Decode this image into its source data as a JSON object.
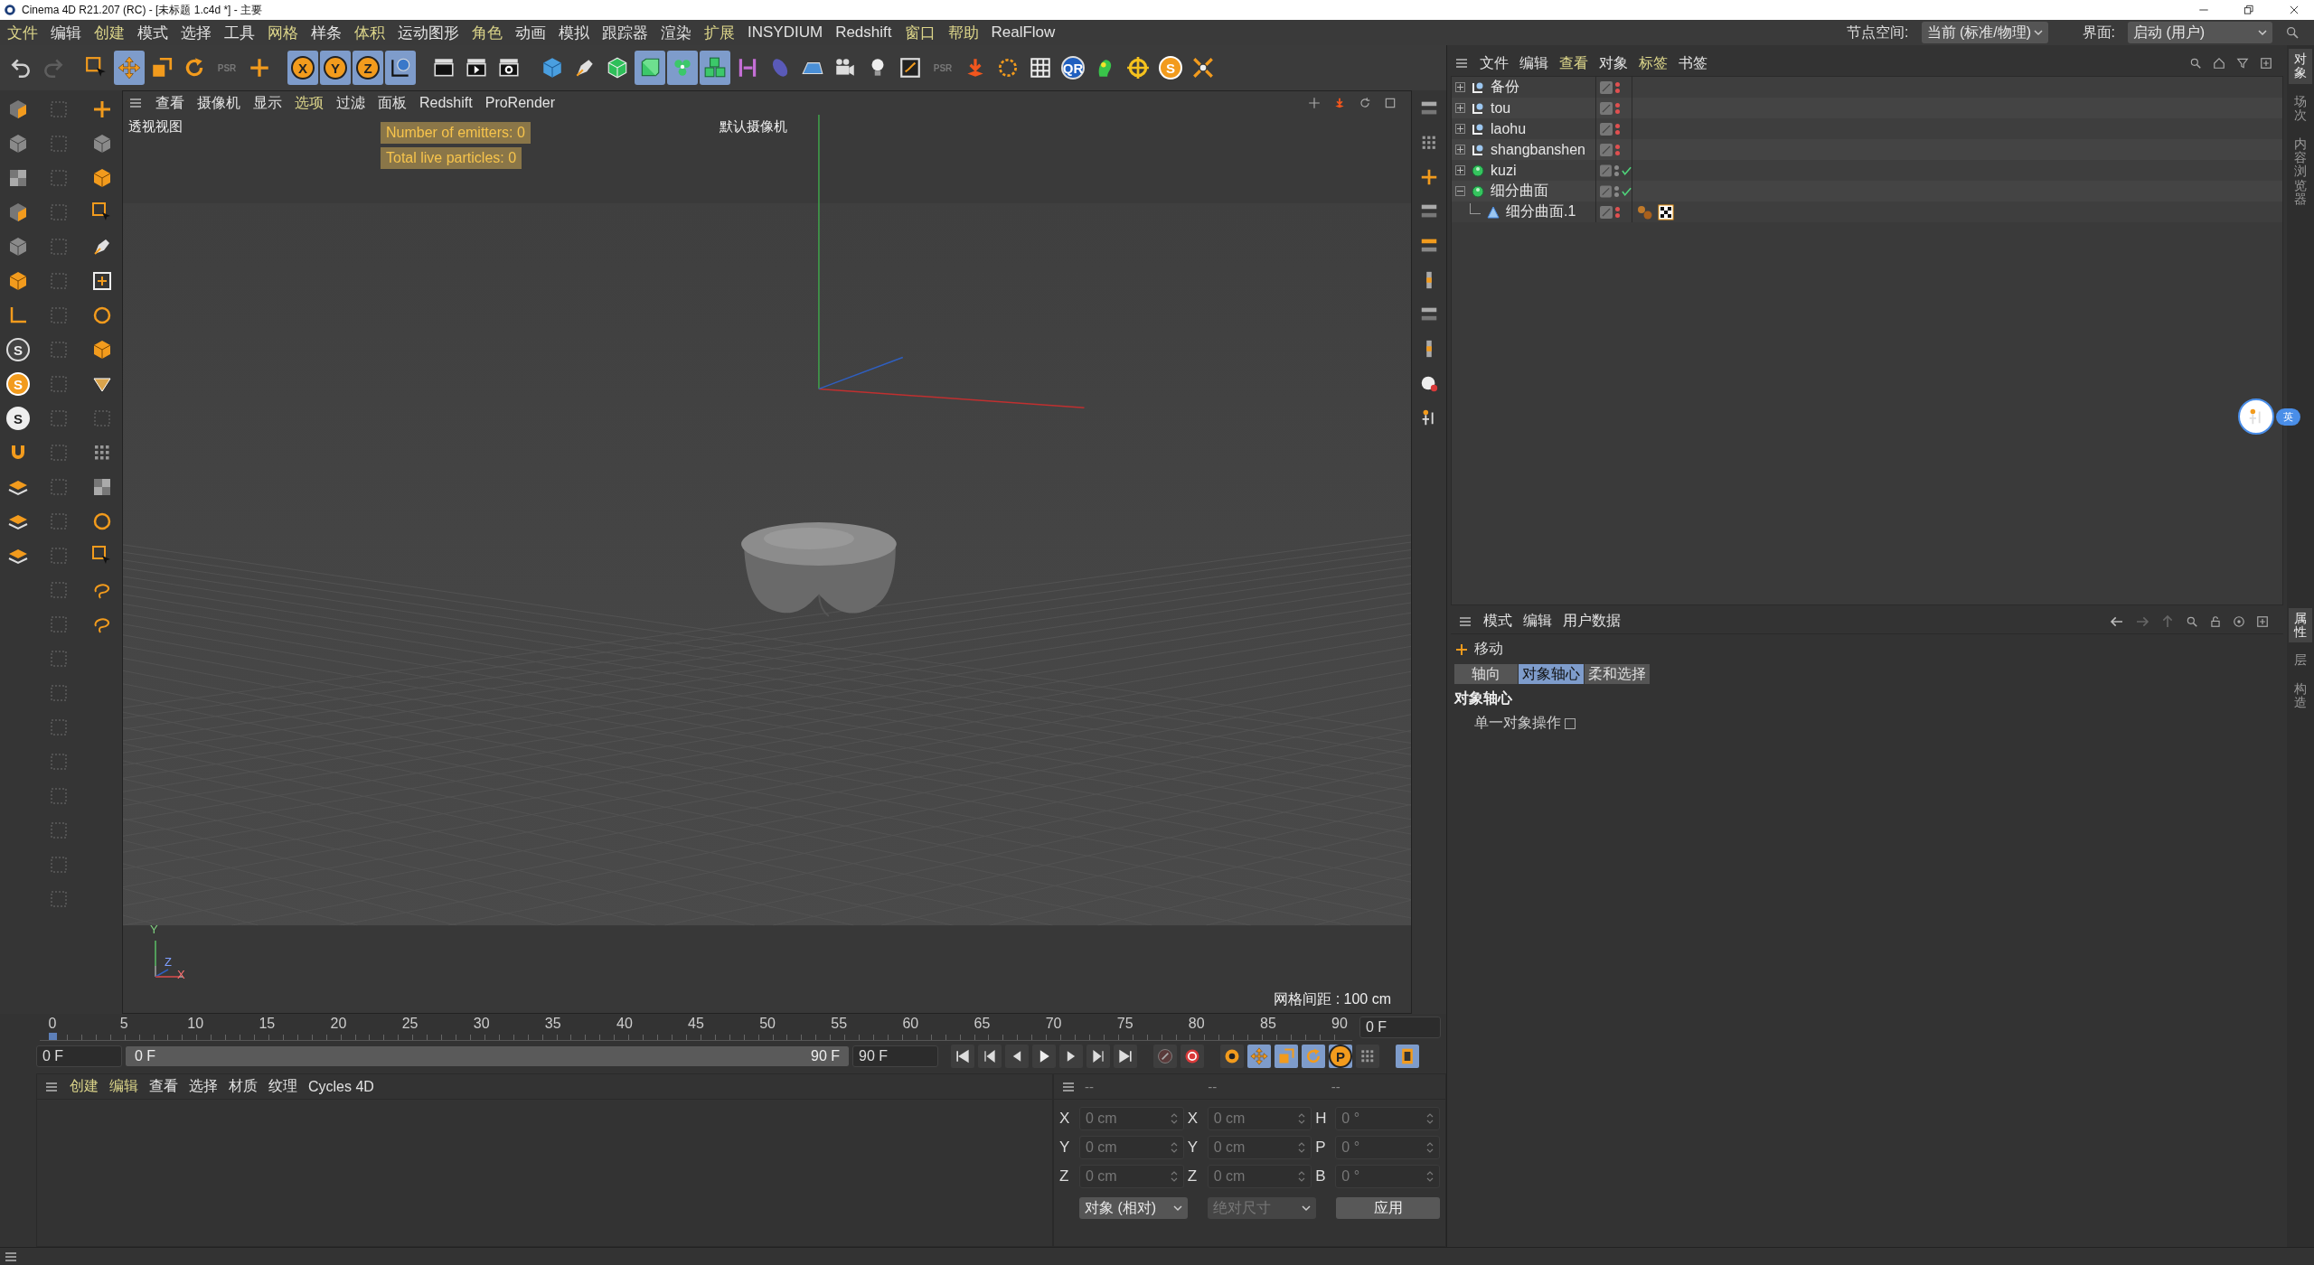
{
  "window": {
    "title": "Cinema 4D R21.207 (RC) - [未标题 1.c4d *] - 主要"
  },
  "menu": [
    {
      "label": "文件",
      "highlighted": true
    },
    {
      "label": "编辑",
      "highlighted": false
    },
    {
      "label": "创建",
      "highlighted": true
    },
    {
      "label": "模式",
      "highlighted": false
    },
    {
      "label": "选择",
      "highlighted": false
    },
    {
      "label": "工具",
      "highlighted": false
    },
    {
      "label": "网格",
      "highlighted": true
    },
    {
      "label": "样条",
      "highlighted": false
    },
    {
      "label": "体积",
      "highlighted": true
    },
    {
      "label": "运动图形",
      "highlighted": false
    },
    {
      "label": "角色",
      "highlighted": true
    },
    {
      "label": "动画",
      "highlighted": false
    },
    {
      "label": "模拟",
      "highlighted": false
    },
    {
      "label": "跟踪器",
      "highlighted": false
    },
    {
      "label": "渲染",
      "highlighted": false
    },
    {
      "label": "扩展",
      "highlighted": true
    },
    {
      "label": "INSYDIUM",
      "highlighted": false
    },
    {
      "label": "Redshift",
      "highlighted": false
    },
    {
      "label": "窗口",
      "highlighted": true
    },
    {
      "label": "帮助",
      "highlighted": true
    },
    {
      "label": "RealFlow",
      "highlighted": false
    }
  ],
  "node_space": {
    "label": "节点空间:",
    "value": "当前 (标准/物理)"
  },
  "interface": {
    "label": "界面:",
    "value": "启动 (用户)"
  },
  "toolbar": [
    {
      "kind": "undo",
      "active": false
    },
    {
      "kind": "redo",
      "active": false
    },
    {
      "kind": "gap"
    },
    {
      "kind": "select",
      "active": false
    },
    {
      "kind": "move",
      "active": true
    },
    {
      "kind": "scale",
      "active": false
    },
    {
      "kind": "rotate",
      "active": false
    },
    {
      "kind": "psr",
      "label": "PSR",
      "active": false
    },
    {
      "kind": "plus",
      "active": false
    },
    {
      "kind": "gap"
    },
    {
      "kind": "axis",
      "label": "X",
      "active": true
    },
    {
      "kind": "axis",
      "label": "Y",
      "active": true
    },
    {
      "kind": "axis",
      "label": "Z",
      "active": true
    },
    {
      "kind": "globe",
      "active": true
    },
    {
      "kind": "gap"
    },
    {
      "kind": "clapper",
      "active": false
    },
    {
      "kind": "clapper-play",
      "active": false
    },
    {
      "kind": "clapper-gear",
      "active": false
    },
    {
      "kind": "gap"
    },
    {
      "kind": "cube",
      "active": false
    },
    {
      "kind": "pen",
      "active": false
    },
    {
      "kind": "subdivision-cube",
      "active": false
    },
    {
      "kind": "solid-cube",
      "active": true
    },
    {
      "kind": "cube-cluster",
      "active": true
    },
    {
      "kind": "cubes",
      "active": true
    },
    {
      "kind": "bracket",
      "active": false
    },
    {
      "kind": "ellipse",
      "active": false
    },
    {
      "kind": "floor",
      "active": false
    },
    {
      "kind": "camera",
      "active": false
    },
    {
      "kind": "bulb",
      "active": false
    },
    {
      "kind": "frame",
      "active": false
    },
    {
      "kind": "psr",
      "label": "PSR",
      "active": false
    },
    {
      "kind": "arrow-down",
      "active": false
    },
    {
      "kind": "ring",
      "active": false
    },
    {
      "kind": "grid",
      "active": false
    },
    {
      "kind": "qr",
      "label": "QR",
      "active": false
    },
    {
      "kind": "bug",
      "active": false
    },
    {
      "kind": "crosshair",
      "active": false
    },
    {
      "kind": "s",
      "label": "S",
      "active": false
    },
    {
      "kind": "arrows-x",
      "active": false
    }
  ],
  "palette_letters": [
    {
      "label": "S",
      "kind": "outline"
    },
    {
      "label": "S",
      "kind": "solid"
    },
    {
      "label": "S",
      "kind": "light"
    }
  ],
  "viewport": {
    "menu": [
      {
        "label": "查看",
        "highlighted": false
      },
      {
        "label": "摄像机",
        "highlighted": false
      },
      {
        "label": "显示",
        "highlighted": false
      },
      {
        "label": "选项",
        "highlighted": true
      },
      {
        "label": "过滤",
        "highlighted": false
      },
      {
        "label": "面板",
        "highlighted": false
      },
      {
        "label": "Redshift",
        "highlighted": false
      },
      {
        "label": "ProRender",
        "highlighted": false
      }
    ],
    "view_name": "透视视图",
    "camera": "默认摄像机",
    "hud": [
      "Number of emitters: 0",
      "Total live particles: 0"
    ],
    "axes": [
      "Y",
      "Z",
      "X"
    ],
    "grid_spacing": "网格间距 : 100 cm"
  },
  "timeline": {
    "range": {
      "level": 1
    },
    "ticks": [
      "0",
      "5",
      "10",
      "15",
      "20",
      "25",
      "30",
      "35",
      "40",
      "45",
      "50",
      "55",
      "60",
      "65",
      "70",
      "75",
      "80",
      "85",
      "90"
    ],
    "current": "0 F",
    "start": "0 F",
    "range_start": "0 F",
    "range_end": "90 F",
    "end": "90 F"
  },
  "key_buttons": [
    {
      "kind": "record",
      "active": false
    },
    {
      "kind": "autokey",
      "active": false
    },
    {
      "kind": "gap"
    },
    {
      "kind": "keyframe",
      "active": false
    },
    {
      "kind": "move",
      "active": true
    },
    {
      "kind": "scale",
      "active": true
    },
    {
      "kind": "rotate",
      "active": true
    },
    {
      "kind": "param",
      "label": "P",
      "active": true
    },
    {
      "kind": "dots",
      "active": false
    },
    {
      "kind": "gap"
    },
    {
      "kind": "film",
      "active": true
    }
  ],
  "material_manager": {
    "menu": [
      {
        "label": "创建",
        "highlighted": true
      },
      {
        "label": "编辑",
        "highlighted": true
      },
      {
        "label": "查看",
        "highlighted": false
      },
      {
        "label": "选择",
        "highlighted": false
      },
      {
        "label": "材质",
        "highlighted": false
      },
      {
        "label": "纹理",
        "highlighted": false
      },
      {
        "label": "Cycles 4D",
        "highlighted": false
      }
    ]
  },
  "coordinates": {
    "headers": [
      "--",
      "--",
      "--"
    ],
    "rows": [
      {
        "axis": "X",
        "position": "0 cm",
        "size_axis": "X",
        "size": "0 cm",
        "rotation_axis": "H",
        "rotation": "0 °"
      },
      {
        "axis": "Y",
        "position": "0 cm",
        "size_axis": "Y",
        "size": "0 cm",
        "rotation_axis": "P",
        "rotation": "0 °"
      },
      {
        "axis": "Z",
        "position": "0 cm",
        "size_axis": "Z",
        "size": "0 cm",
        "rotation_axis": "B",
        "rotation": "0 °"
      }
    ],
    "mode": {
      "value": "对象 (相对)",
      "disabled": false
    },
    "size_mode": {
      "value": "绝对尺寸",
      "disabled": true
    },
    "apply": "应用"
  },
  "object_manager": {
    "menu": [
      {
        "label": "文件",
        "highlighted": false
      },
      {
        "label": "编辑",
        "highlighted": false
      },
      {
        "label": "查看",
        "highlighted": true
      },
      {
        "label": "对象",
        "highlighted": false
      },
      {
        "label": "标签",
        "highlighted": true
      },
      {
        "label": "书签",
        "highlighted": false
      }
    ],
    "objects": [
      {
        "name": "备份",
        "kind": "null",
        "expanded": false,
        "hidden": true
      },
      {
        "name": "tou",
        "kind": "null",
        "expanded": false,
        "hidden": true
      },
      {
        "name": "laohu",
        "kind": "null",
        "expanded": false,
        "hidden": true
      },
      {
        "name": "shangbanshen",
        "kind": "null",
        "expanded": false,
        "hidden": true
      },
      {
        "name": "kuzi",
        "kind": "generator",
        "expanded": false,
        "hidden": false,
        "enabled": true
      },
      {
        "name": "细分曲面",
        "kind": "generator",
        "expanded": true,
        "hidden": false,
        "enabled": true,
        "children": [
          {
            "name": "细分曲面.1",
            "kind": "polygon",
            "hidden": true
          }
        ]
      }
    ]
  },
  "side_tabs_top": [
    {
      "label": "对象",
      "selected": true
    },
    {
      "label": "场次",
      "selected": false
    },
    {
      "label": "内容浏览器",
      "selected": false
    }
  ],
  "attributes": {
    "menu": [
      "模式",
      "编辑",
      "用户数据"
    ],
    "tool": "移动",
    "tabs": [
      {
        "label": "轴向",
        "selected": false
      },
      {
        "label": "对象轴心",
        "selected": true
      },
      {
        "label": "柔和选择",
        "selected": false
      }
    ],
    "section": "对象轴心",
    "options": [
      {
        "label": "单一对象操作",
        "checked": false
      }
    ]
  },
  "side_tabs_bottom": [
    {
      "label": "属性",
      "selected": true
    },
    {
      "label": "层",
      "selected": false
    },
    {
      "label": "构造",
      "selected": false
    }
  ],
  "ime": {
    "label": "英"
  }
}
